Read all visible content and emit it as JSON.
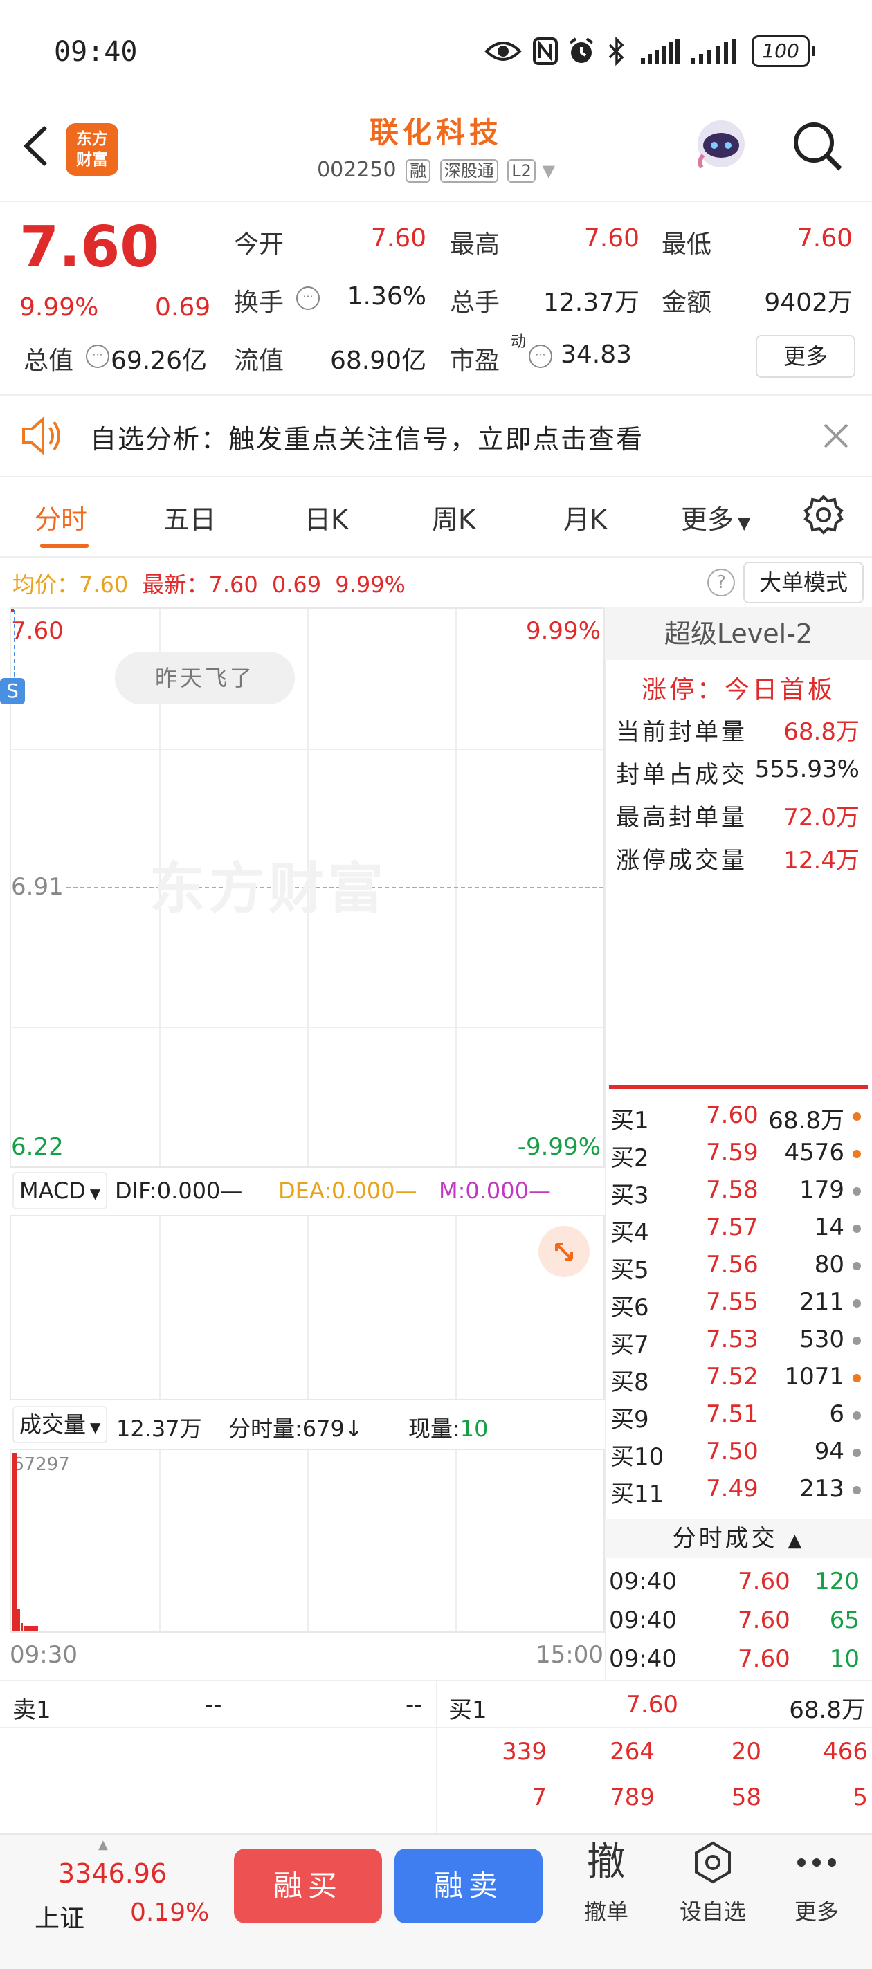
{
  "status_bar": {
    "time": "09:40",
    "battery": "100"
  },
  "header": {
    "logo_line1": "东方",
    "logo_line2": "财富",
    "title": "联化科技",
    "code": "002250",
    "tags": [
      "融",
      "深股通",
      "L2"
    ]
  },
  "quote": {
    "price": "7.60",
    "change_pct": "9.99%",
    "change": "0.69",
    "open_label": "今开",
    "open": "7.60",
    "high_label": "最高",
    "high": "7.60",
    "low_label": "最低",
    "low": "7.60",
    "turnover_label": "换手",
    "turnover": "1.36%",
    "volume_label": "总手",
    "volume": "12.37万",
    "amount_label": "金额",
    "amount": "9402万",
    "total_mv_label": "总值",
    "total_mv": "69.26亿",
    "float_mv_label": "流值",
    "float_mv": "68.90亿",
    "pe_label": "市盈",
    "pe_sup": "动",
    "pe": "34.83",
    "more_label": "更多"
  },
  "notice": {
    "text": "自选分析：触发重点关注信号，立即点击查看"
  },
  "tabs": [
    "分时",
    "五日",
    "日K",
    "周K",
    "月K",
    "更多"
  ],
  "info_line": {
    "avg_label": "均价：",
    "avg": "7.60",
    "last_label": "最新：",
    "last": "7.60",
    "last_change": "0.69",
    "last_pct": "9.99%",
    "big_order_label": "大单模式"
  },
  "chart": {
    "top_price": "7.60",
    "top_pct": "9.99%",
    "mid_price": "6.91",
    "bottom_price": "6.22",
    "bottom_pct": "-9.99%",
    "bubble": "昨天飞了",
    "watermark": "东方财富",
    "s_badge": "S"
  },
  "macd": {
    "selector": "MACD",
    "dif": "DIF:0.000",
    "dea": "DEA:0.000",
    "m": "M:0.000"
  },
  "volume_panel": {
    "selector": "成交量",
    "total": "12.37万",
    "minute_label": "分时量:",
    "minute": "679",
    "now_label": "现量:",
    "now": "10",
    "max": "67297",
    "start_time": "09:30",
    "end_time": "15:00"
  },
  "level2": {
    "title": "超级Level-2",
    "limit_up_label": "涨停：今日首板",
    "rows": [
      {
        "label": "当前封单量",
        "value": "68.8万"
      },
      {
        "label": "封单占成交",
        "value": "555.93%"
      },
      {
        "label": "最高封单量",
        "value": "72.0万"
      },
      {
        "label": "涨停成交量",
        "value": "12.4万"
      }
    ]
  },
  "order_book": [
    {
      "label": "买1",
      "price": "7.60",
      "vol": "68.8万",
      "dot": "#f0781e"
    },
    {
      "label": "买2",
      "price": "7.59",
      "vol": "4576",
      "dot": "#f0781e"
    },
    {
      "label": "买3",
      "price": "7.58",
      "vol": "179",
      "dot": "#999999"
    },
    {
      "label": "买4",
      "price": "7.57",
      "vol": "14",
      "dot": "#999999"
    },
    {
      "label": "买5",
      "price": "7.56",
      "vol": "80",
      "dot": "#999999"
    },
    {
      "label": "买6",
      "price": "7.55",
      "vol": "211",
      "dot": "#999999"
    },
    {
      "label": "买7",
      "price": "7.53",
      "vol": "530",
      "dot": "#999999"
    },
    {
      "label": "买8",
      "price": "7.52",
      "vol": "1071",
      "dot": "#f0781e"
    },
    {
      "label": "买9",
      "price": "7.51",
      "vol": "6",
      "dot": "#999999"
    },
    {
      "label": "买10",
      "price": "7.50",
      "vol": "94",
      "dot": "#999999"
    },
    {
      "label": "买11",
      "price": "7.49",
      "vol": "213",
      "dot": "#999999"
    }
  ],
  "ticks": {
    "title": "分时成交",
    "rows": [
      {
        "time": "09:40",
        "price": "7.60",
        "vol": "120"
      },
      {
        "time": "09:40",
        "price": "7.60",
        "vol": "65"
      },
      {
        "time": "09:40",
        "price": "7.60",
        "vol": "10"
      }
    ]
  },
  "bottom_book": {
    "sell_label": "卖1",
    "sell_price": "--",
    "sell_vol": "--",
    "buy_label": "买1",
    "buy_price": "7.60",
    "buy_vol": "68.8万",
    "queue_row1": [
      "339",
      "264",
      "20",
      "466"
    ],
    "queue_row2": [
      "7",
      "789",
      "58",
      "5"
    ]
  },
  "footer": {
    "index_value": "3346.96",
    "index_name": "上证",
    "index_pct": "0.19%",
    "buy_label": "融买",
    "sell_label": "融卖",
    "cancel_icon": "撤",
    "cancel_label": "撤单",
    "watch_label": "设自选",
    "more_label": "更多"
  },
  "colors": {
    "up": "#e02b2b",
    "down": "#15a046",
    "brand": "#f06a1e",
    "buy_btn": "#ee5151",
    "sell_btn": "#3f7ef0"
  }
}
